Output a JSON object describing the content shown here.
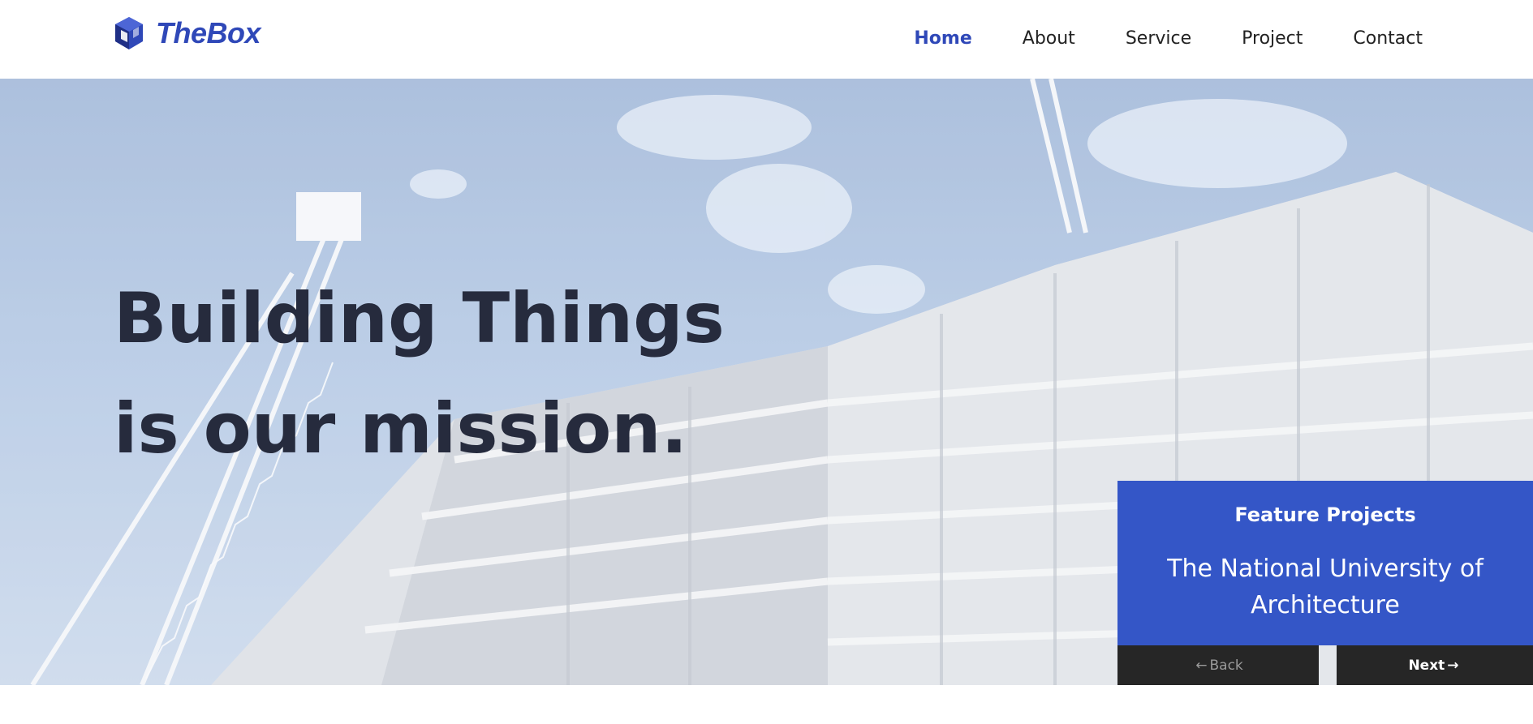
{
  "brand": {
    "name": "TheBox",
    "logo_icon": "cube-logo-icon",
    "color": "#2f48b8"
  },
  "nav": {
    "items": [
      {
        "label": "Home",
        "active": true
      },
      {
        "label": "About",
        "active": false
      },
      {
        "label": "Service",
        "active": false
      },
      {
        "label": "Project",
        "active": false
      },
      {
        "label": "Contact",
        "active": false
      }
    ]
  },
  "hero": {
    "line1": "Building Things",
    "line2": "is our mission."
  },
  "feature": {
    "heading": "Feature Projects",
    "project_name": "The National University of Architecture",
    "back_label": "Back",
    "next_label": "Next",
    "back_icon": "arrow-left-icon",
    "next_icon": "arrow-right-icon",
    "accent": "#3456c7"
  }
}
